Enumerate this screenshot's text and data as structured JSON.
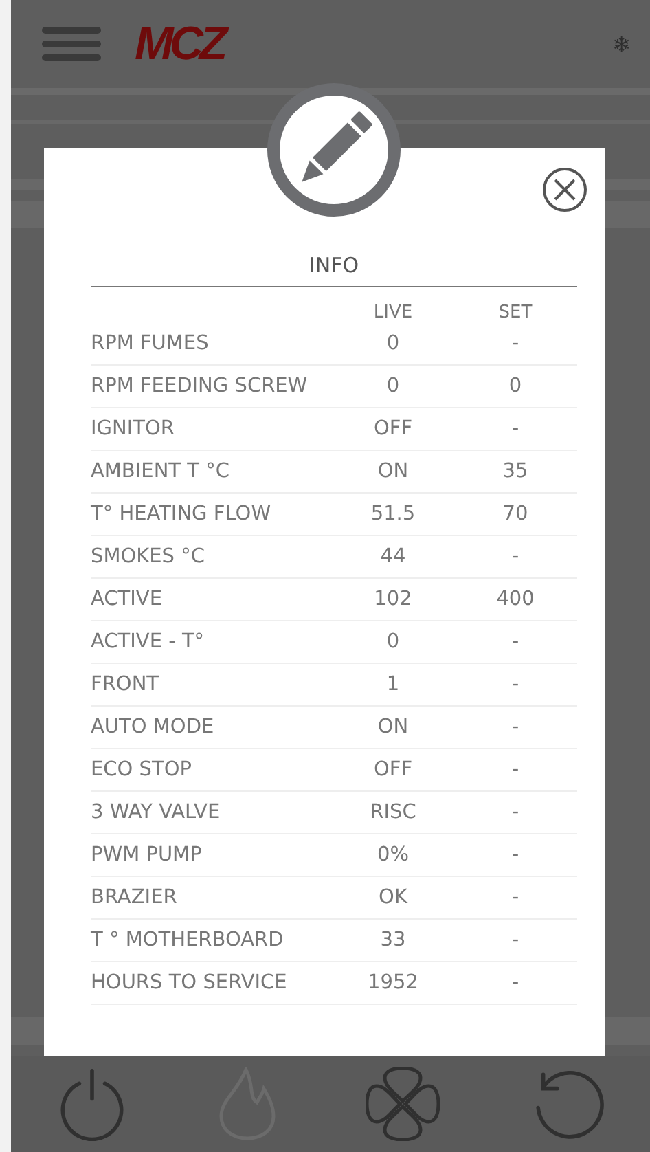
{
  "header": {
    "logo": "MCZ",
    "snowflake": "❄"
  },
  "dialog": {
    "title": "INFO",
    "columns": [
      "LIVE",
      "SET"
    ],
    "rows": [
      {
        "label": "RPM FUMES",
        "live": "0",
        "set": "-"
      },
      {
        "label": "RPM FEEDING SCREW",
        "live": "0",
        "set": "0"
      },
      {
        "label": "IGNITOR",
        "live": "OFF",
        "set": "-"
      },
      {
        "label": "AMBIENT T °C",
        "live": "ON",
        "set": "35"
      },
      {
        "label": "T° HEATING FLOW",
        "live": "51.5",
        "set": "70"
      },
      {
        "label": "SMOKES °C",
        "live": "44",
        "set": "-"
      },
      {
        "label": "ACTIVE",
        "live": "102",
        "set": "400"
      },
      {
        "label": "ACTIVE - T°",
        "live": "0",
        "set": "-"
      },
      {
        "label": "FRONT",
        "live": "1",
        "set": "-"
      },
      {
        "label": "AUTO MODE",
        "live": "ON",
        "set": "-"
      },
      {
        "label": "ECO STOP",
        "live": "OFF",
        "set": "-"
      },
      {
        "label": "3 WAY VALVE",
        "live": "RISC",
        "set": "-"
      },
      {
        "label": "PWM PUMP",
        "live": "0%",
        "set": "-"
      },
      {
        "label": "BRAZIER",
        "live": "OK",
        "set": "-"
      },
      {
        "label": "T ° MOTHERBOARD",
        "live": "33",
        "set": "-"
      },
      {
        "label": "HOURS TO SERVICE",
        "live": "1952",
        "set": "-"
      }
    ]
  },
  "bottom_bar": [
    {
      "kind": "power",
      "disabled": false
    },
    {
      "kind": "flame",
      "disabled": true
    },
    {
      "kind": "fan",
      "disabled": false
    },
    {
      "kind": "reset",
      "disabled": false
    }
  ]
}
